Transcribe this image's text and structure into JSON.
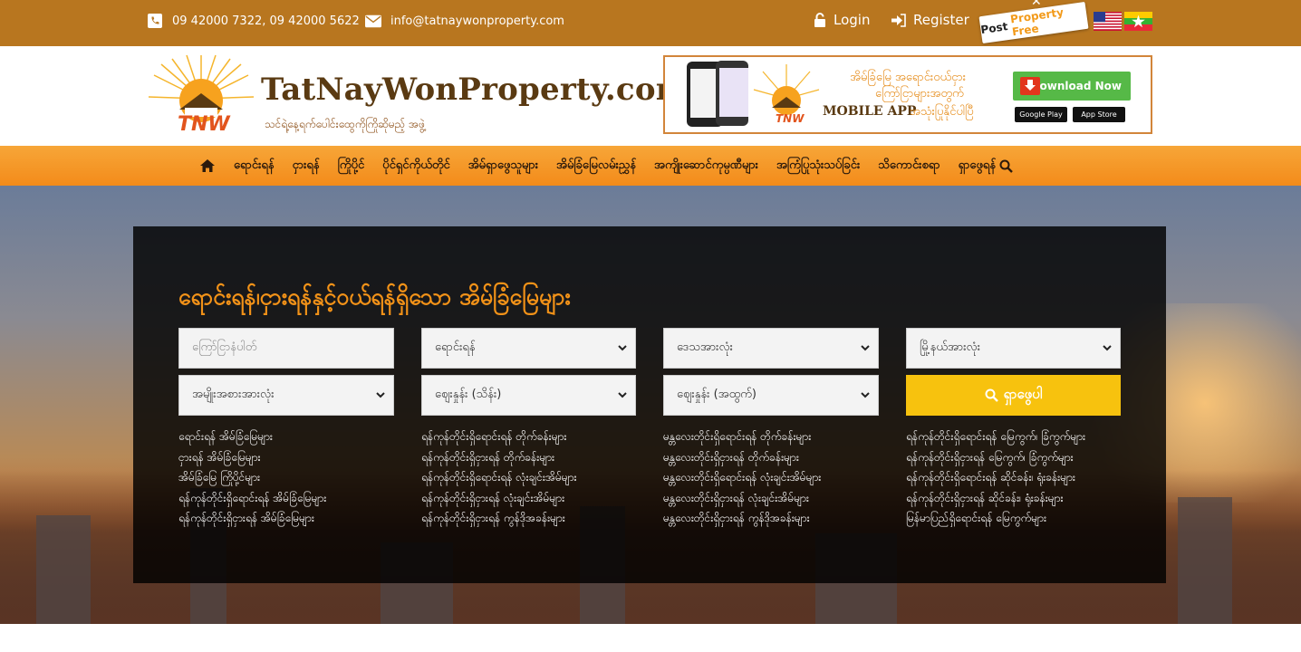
{
  "topbar": {
    "phone": "09 42000 7322, 09 42000 5622",
    "email": "info@tatnaywonproperty.com",
    "login": "Login",
    "register": "Register",
    "post_free": {
      "post": "Post",
      "property_free": "Property Free"
    },
    "close": "✕",
    "icons": {
      "phone": "phone-icon",
      "email": "envelope-icon",
      "login": "lock-icon",
      "register": "sign-in-icon"
    },
    "languages": [
      "English",
      "Myanmar"
    ]
  },
  "header": {
    "logo": {
      "brand": "TatNayWonProperty.com",
      "tagline": "သင်ရဲ့နေ့ရက်ပေါင်းထွေကိုကြိုဆိုမည့် အဖွဲ့",
      "monogram": "TNW"
    },
    "banner": {
      "line1": "အိမ်ခြံမြေ အရောင်းဝယ်ငှား",
      "line2": "ကြော်ငြာများအတွက်",
      "mobile_app": "MOBILE APP",
      "line3": "အသုံးပြုနိုင်ပါပြီ",
      "download": "Download Now",
      "google_play": "Google Play",
      "app_store": "App Store"
    }
  },
  "nav": {
    "items": [
      "ရောင်းရန်",
      "ငှားရန်",
      "ကြိုပို့င်",
      "ပိုင်ရှင်ကိုယ်တိုင်",
      "အိမ်ရှာဖွေသူများ",
      "အိမ်ခြံမြေလမ်းညွှန်",
      "အကျိုးဆောင်ကုမ္ပဏီများ",
      "အကြံပြုသုံးသပ်ခြင်း",
      "သိကောင်းစရာ",
      "ရှာဖွေရန်"
    ]
  },
  "search": {
    "title": "ရောင်းရန်၊ငှားရန်နှင့်ဝယ်ရန်ရှိသော အိမ်ခြံမြေများ",
    "keyword_placeholder": "ကြော်ငြာနံပါတ်",
    "type_value": "ရောင်းရန်",
    "region_value": "ဒေသအားလုံး",
    "township_value": "မြို့နယ်အားလုံး",
    "category_value": "အမျိုးအစားအားလုံး",
    "min_price_value": "စျေးနှုန်း (သိန်း)",
    "max_price_value": "စျေးနှုန်း (အထွက်)",
    "button": "ရှာဖွေပါ",
    "links": [
      [
        "ရောင်းရန် အိမ်ခြံမြေများ",
        "ငှားရန် အိမ်ခြံမြေများ",
        "အိမ်ခြံမြေ ကြိုပို့င်များ",
        "ရန်ကုန်တိုင်းရှိရောင်းရန် အိမ်ခြံမြေများ",
        "ရန်ကုန်တိုင်းရှိငှားရန် အိမ်ခြံမြေများ"
      ],
      [
        "ရန်ကုန်တိုင်းရှိရောင်းရန် တိုက်ခန်းများ",
        "ရန်ကုန်တိုင်းရှိငှားရန် တိုက်ခန်းများ",
        "ရန်ကုန်တိုင်းရှိရောင်းရန် လုံးချင်းအိမ်များ",
        "ရန်ကုန်တိုင်းရှိငှားရန် လုံးချင်းအိမ်များ",
        "ရန်ကုန်တိုင်းရှိငှားရန် ကွန်ဒိုအခန်းများ"
      ],
      [
        "မန္တလေးတိုင်းရှိရောင်းရန် တိုက်ခန်းများ",
        "မန္တလေးတိုင်းရှိငှားရန် တိုက်ခန်းများ",
        "မန္တလေးတိုင်းရှိရောင်းရန် လုံးချင်းအိမ်များ",
        "မန္တလေးတိုင်းရှိငှားရန် လုံးချင်းအိမ်များ",
        "မန္တလေးတိုင်းရှိငှားရန် ကွန်ဒိုအခန်းများ"
      ],
      [
        "ရန်ကုန်တိုင်းရှိရောင်းရန် မြေကွက်၊ ခြံကွက်များ",
        "ရန်ကုန်တိုင်းရှိငှားရန် မြေကွက်၊ ခြံကွက်များ",
        "ရန်ကုန်တိုင်းရှိရောင်းရန် ဆိုင်ခန်း၊ ရုံးခန်းများ",
        "ရန်ကုန်တိုင်းရှိငှားရန် ဆိုင်ခန်း၊ ရုံးခန်းများ",
        "မြန်မာပြည်ရှိရောင်းရန် မြေကွက်များ"
      ]
    ]
  },
  "colors": {
    "topbar": "#b8761f",
    "nav": "#f39a28",
    "accent_orange": "#f29218",
    "search_button": "#f7c20e"
  }
}
